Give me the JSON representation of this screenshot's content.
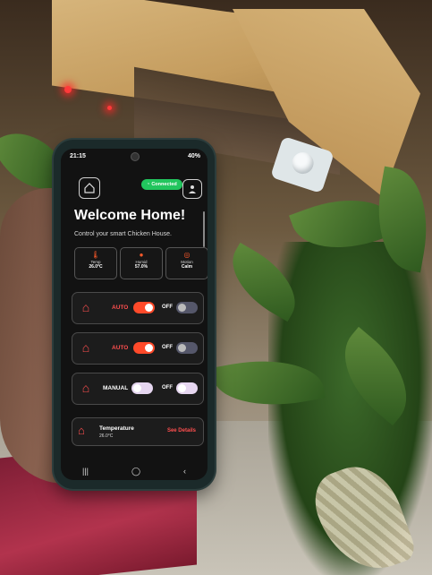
{
  "photo": {
    "description_icons": [
      "hand-icon",
      "chicken-house-model-icon",
      "plant-icon"
    ]
  },
  "phone": {
    "status_bar": {
      "time": "21:15",
      "battery": "40%"
    },
    "header": {
      "logo_icon": "chicken-house-icon",
      "connection": "Connected",
      "profile_icon": "user-icon"
    },
    "title": "Welcome Home!",
    "subtitle": "Control your smart Chicken House.",
    "stats": [
      {
        "label": "Temp",
        "value": "26.0°C",
        "icon": "thermometer-icon"
      },
      {
        "label": "Humid",
        "value": "57.0%",
        "icon": "droplet-icon"
      },
      {
        "label": "Motion",
        "value": "Calm",
        "icon": "target-icon"
      }
    ],
    "controls": [
      {
        "mode": "AUTO",
        "off_label": "OFF",
        "icon": "fan-house-icon"
      },
      {
        "mode": "AUTO",
        "off_label": "OFF",
        "icon": "lamp-house-icon"
      },
      {
        "mode": "MANUAL",
        "off_label": "OFF",
        "icon": "feeder-icon"
      }
    ],
    "temperature_card": {
      "title": "Temperature",
      "value": "26.0°C",
      "link": "See Details"
    },
    "nav": {
      "recent": "|||",
      "home": "◯",
      "back": "‹"
    },
    "colors": {
      "accent": "#ff4f4f",
      "toggle_on": "#ff4a2a",
      "connected": "#22c55e"
    }
  }
}
